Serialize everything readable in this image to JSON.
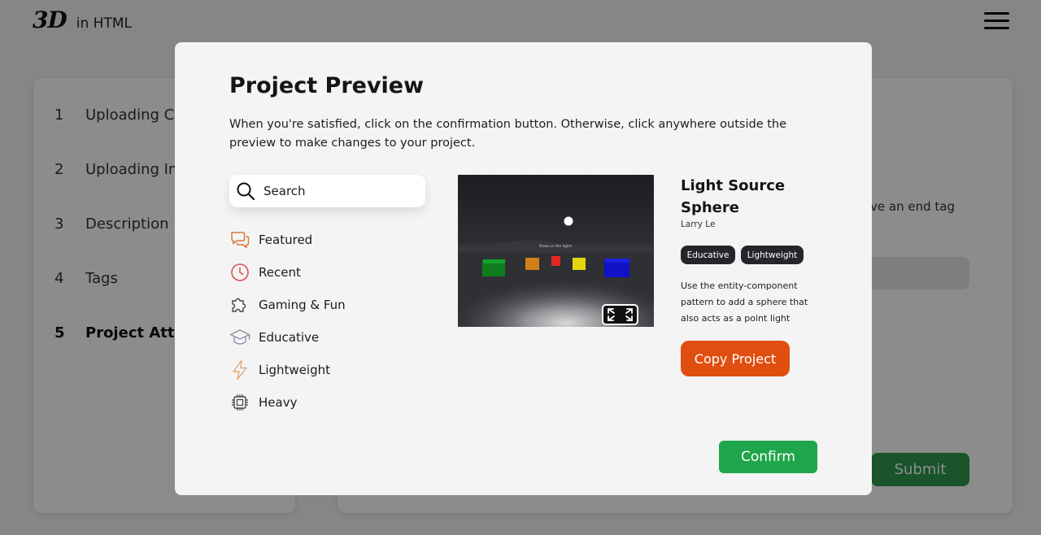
{
  "header": {
    "logo_mark": "3D",
    "logo_text": "in HTML"
  },
  "steps": [
    {
      "num": "1",
      "label": "Uploading Co"
    },
    {
      "num": "2",
      "label": "Uploading Im"
    },
    {
      "num": "3",
      "label": "Description"
    },
    {
      "num": "4",
      "label": "Tags"
    },
    {
      "num": "5",
      "label": "Project Attrib"
    }
  ],
  "form": {
    "hint_fragment": "ve an end tag",
    "submit_label": "Submit"
  },
  "modal": {
    "title": "Project Preview",
    "description": "When you're satisfied, click on the confirmation button. Otherwise, click anywhere outside the preview to make changes to your project.",
    "search_label": "Search",
    "categories": [
      {
        "label": "Featured",
        "icon": "chat-bubbles-icon"
      },
      {
        "label": "Recent",
        "icon": "clock-icon"
      },
      {
        "label": "Gaming & Fun",
        "icon": "puzzle-icon"
      },
      {
        "label": "Educative",
        "icon": "graduation-cap-icon"
      },
      {
        "label": "Lightweight",
        "icon": "lightning-icon"
      },
      {
        "label": "Heavy",
        "icon": "chip-icon"
      }
    ],
    "preview_scene_text": "Show us the light!",
    "project": {
      "title": "Light Source Sphere",
      "author": "Larry Le",
      "tags": [
        "Educative",
        "Lightweight"
      ],
      "description": "Use the entity-component pattern to add a sphere that also acts as a point light",
      "copy_label": "Copy Project"
    },
    "confirm_label": "Confirm"
  },
  "colors": {
    "copy_button": "#e04e10",
    "confirm_button": "#1fa64a",
    "submit_button": "#2f9a4e",
    "tag_bg": "#24262a",
    "featured_icon": "#d9783a",
    "recent_icon": "#d9534f",
    "lightning_icon": "#e0a878"
  }
}
